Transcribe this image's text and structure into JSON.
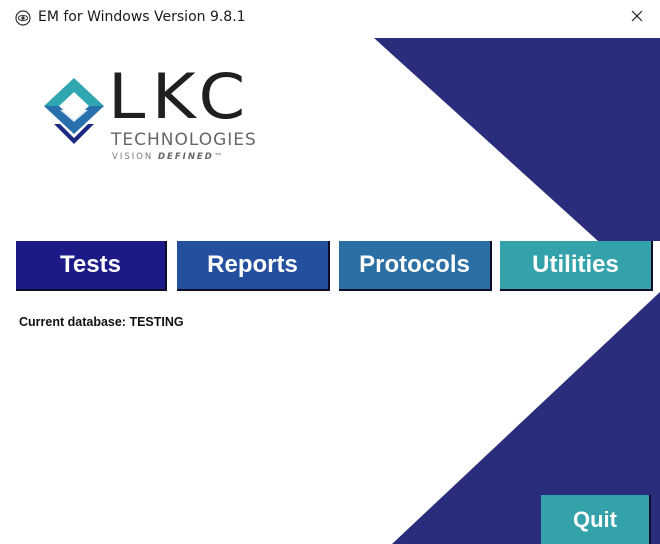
{
  "window": {
    "title": "EM for Windows Version 9.8.1",
    "app_icon": "eye-icon",
    "close_icon": "close-icon"
  },
  "logo": {
    "mark_icon": "lkc-diamond-logo-icon",
    "wordmark": "LKC",
    "technologies": "TECHNOLOGIES",
    "tagline_prefix": "VISION ",
    "tagline_emphasis": "DEFINED",
    "tagline_tm": "™"
  },
  "nav": {
    "tests_label": "Tests",
    "reports_label": "Reports",
    "protocols_label": "Protocols",
    "utilities_label": "Utilities"
  },
  "status": {
    "current_database": "Current database: TESTING"
  },
  "actions": {
    "quit_label": "Quit"
  },
  "colors": {
    "navy_background": "#2a2d7c",
    "tests": "#1c1a86",
    "reports": "#244f9f",
    "protocols": "#2b6fa4",
    "utilities": "#33a2aa",
    "quit": "#33a2aa"
  }
}
